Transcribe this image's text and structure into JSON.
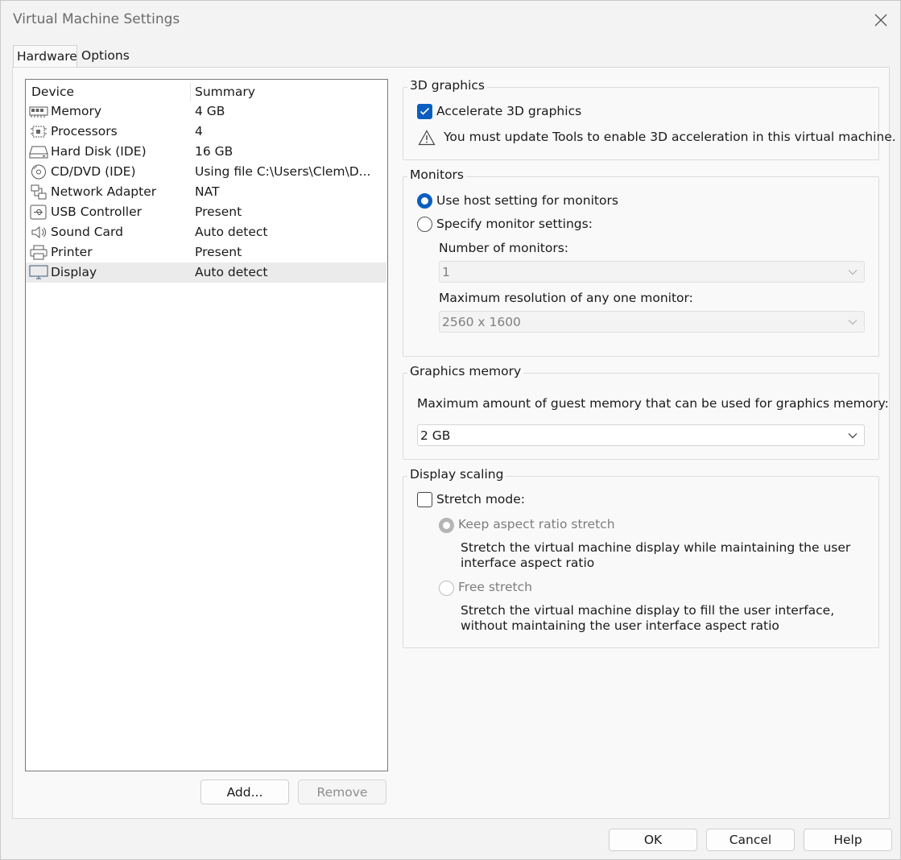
{
  "window": {
    "title": "Virtual Machine Settings"
  },
  "tabs": [
    {
      "label": "Hardware",
      "active": true
    },
    {
      "label": "Options",
      "active": false
    }
  ],
  "device_list": {
    "headers": {
      "device": "Device",
      "summary": "Summary"
    },
    "rows": [
      {
        "icon": "memory-icon",
        "name": "Memory",
        "summary": "4 GB"
      },
      {
        "icon": "processor-icon",
        "name": "Processors",
        "summary": "4"
      },
      {
        "icon": "hard-disk-icon",
        "name": "Hard Disk (IDE)",
        "summary": "16 GB"
      },
      {
        "icon": "cd-dvd-icon",
        "name": "CD/DVD (IDE)",
        "summary": "Using file C:\\Users\\Clem\\D..."
      },
      {
        "icon": "network-icon",
        "name": "Network Adapter",
        "summary": "NAT"
      },
      {
        "icon": "usb-icon",
        "name": "USB Controller",
        "summary": "Present"
      },
      {
        "icon": "speaker-icon",
        "name": "Sound Card",
        "summary": "Auto detect"
      },
      {
        "icon": "printer-icon",
        "name": "Printer",
        "summary": "Present"
      },
      {
        "icon": "display-icon",
        "name": "Display",
        "summary": "Auto detect",
        "selected": true
      }
    ]
  },
  "list_buttons": {
    "add": "Add...",
    "remove": "Remove"
  },
  "graphics_3d": {
    "legend": "3D graphics",
    "accelerate_label": "Accelerate 3D graphics",
    "accelerate_checked": true,
    "warning": "You must update Tools to enable 3D acceleration in this virtual machine."
  },
  "monitors": {
    "legend": "Monitors",
    "use_host_label": "Use host setting for monitors",
    "specify_label": "Specify monitor settings:",
    "selected": "use_host",
    "num_monitors_label": "Number of monitors:",
    "num_monitors_value": "1",
    "max_res_label": "Maximum resolution of any one monitor:",
    "max_res_value": "2560 x 1600"
  },
  "graphics_memory": {
    "legend": "Graphics memory",
    "description": "Maximum amount of guest memory that can be used for graphics memory:",
    "value": "2 GB"
  },
  "display_scaling": {
    "legend": "Display scaling",
    "stretch_label": "Stretch mode:",
    "stretch_checked": false,
    "keep_aspect_label": "Keep aspect ratio stretch",
    "keep_aspect_desc": "Stretch the virtual machine display while maintaining the user interface aspect ratio",
    "free_stretch_label": "Free stretch",
    "free_stretch_desc": "Stretch the virtual machine display to fill the user interface, without maintaining the user interface aspect ratio"
  },
  "footer": {
    "ok": "OK",
    "cancel": "Cancel",
    "help": "Help"
  },
  "colors": {
    "accent": "#0a5ec0",
    "background": "#f3f3f3",
    "panel": "#f9f9f9"
  }
}
